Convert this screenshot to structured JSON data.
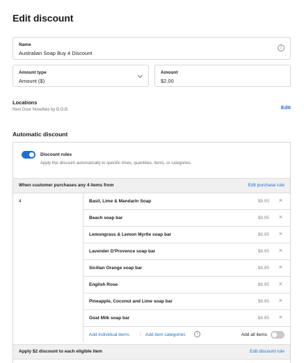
{
  "page": {
    "title": "Edit discount"
  },
  "name_field": {
    "label": "Name",
    "value": "Australian Soap Buy 4 Discount",
    "info_icon": "info-icon"
  },
  "amount_type": {
    "label": "Amount type",
    "value": "Amount ($)"
  },
  "amount": {
    "label": "Amount",
    "value": "$2.00"
  },
  "locations": {
    "title": "Locations",
    "subtitle": "Next Door Novelties by B.O.B.",
    "edit_label": "Edit"
  },
  "automatic": {
    "title": "Automatic discount",
    "rules_title": "Discount rules",
    "rules_subtitle": "Apply this discount automatically to specific times, quantities, items, or categories.",
    "rules_enabled": true,
    "purchase_band": "When customer purchases any 4 items from",
    "purchase_link": "Edit purchase rule",
    "quantity": "4",
    "items": [
      {
        "name": "Basil, Lime & Mandarin Soap",
        "price": "$8.95"
      },
      {
        "name": "Beach soap bar",
        "price": "$8.95"
      },
      {
        "name": "Lemongrass & Lemon Myrtle soap bar",
        "price": "$8.95"
      },
      {
        "name": "Lavender D'Provence soap bar",
        "price": "$8.95"
      },
      {
        "name": "Sicilian Orange soap bar",
        "price": "$8.95"
      },
      {
        "name": "English Rose",
        "price": "$8.95"
      },
      {
        "name": "Pineapple, Coconut and Lime soap bar",
        "price": "$8.95"
      },
      {
        "name": "Goat Milk soap bar",
        "price": "$8.95"
      }
    ],
    "remove_glyph": "×",
    "add_items": "Add individual items",
    "separator": "|",
    "add_categories": "Add item categories",
    "all_items_label": "Add all items",
    "all_items_enabled": false,
    "discount_band": "Apply $2 discount to each eligible item",
    "discount_link": "Edit discount rule"
  },
  "colors": {
    "accent": "#1f6fd1",
    "muted": "#707070",
    "border": "#d6d6d6",
    "band": "#f0f0f0"
  }
}
